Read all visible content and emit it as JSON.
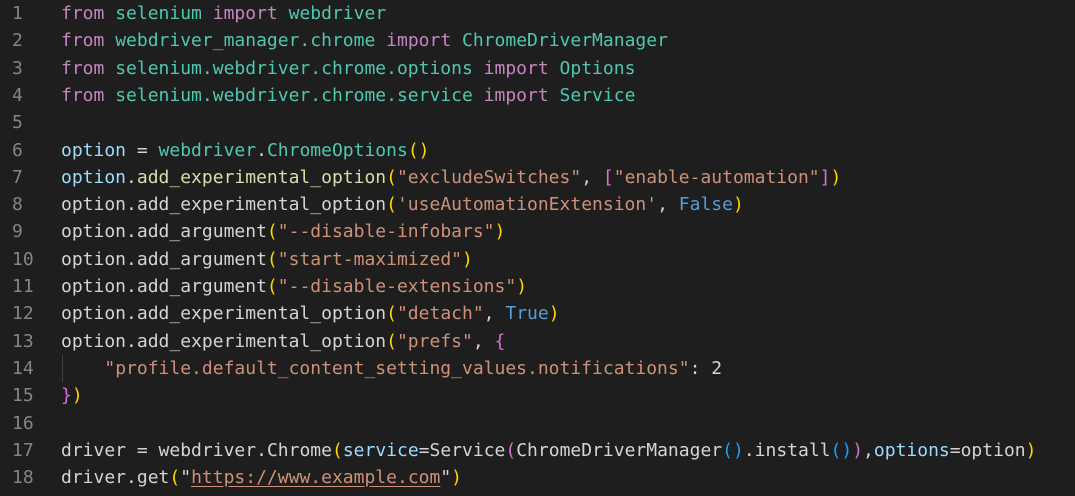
{
  "colors": {
    "background": "#1e1e1e",
    "keyword": "#c586c0",
    "module": "#4ec9b0",
    "function": "#dcdcaa",
    "variable": "#9cdcfe",
    "string": "#ce9178",
    "constant": "#569cd6",
    "bracket_gold": "#ffd700",
    "bracket_purple": "#da70d6",
    "bracket_blue": "#179fff",
    "line_number": "#858585"
  },
  "lines": [
    {
      "num": "1",
      "tokens": [
        {
          "text": "from",
          "cls": "kw"
        },
        {
          "text": " "
        },
        {
          "text": "selenium",
          "cls": "mod"
        },
        {
          "text": " "
        },
        {
          "text": "import",
          "cls": "kw"
        },
        {
          "text": " "
        },
        {
          "text": "webdriver",
          "cls": "mod"
        }
      ]
    },
    {
      "num": "2",
      "tokens": [
        {
          "text": "from",
          "cls": "kw"
        },
        {
          "text": " "
        },
        {
          "text": "webdriver_manager.chrome",
          "cls": "mod"
        },
        {
          "text": " "
        },
        {
          "text": "import",
          "cls": "kw"
        },
        {
          "text": " "
        },
        {
          "text": "ChromeDriverManager",
          "cls": "mod"
        }
      ]
    },
    {
      "num": "3",
      "tokens": [
        {
          "text": "from",
          "cls": "kw"
        },
        {
          "text": " "
        },
        {
          "text": "selenium.webdriver.chrome.options",
          "cls": "mod"
        },
        {
          "text": " "
        },
        {
          "text": "import",
          "cls": "kw"
        },
        {
          "text": " "
        },
        {
          "text": "Options",
          "cls": "mod"
        }
      ]
    },
    {
      "num": "4",
      "tokens": [
        {
          "text": "from",
          "cls": "kw"
        },
        {
          "text": " "
        },
        {
          "text": "selenium.webdriver.chrome.service",
          "cls": "mod"
        },
        {
          "text": " "
        },
        {
          "text": "import",
          "cls": "kw"
        },
        {
          "text": " "
        },
        {
          "text": "Service",
          "cls": "mod"
        }
      ]
    },
    {
      "num": "5",
      "tokens": []
    },
    {
      "num": "6",
      "tokens": [
        {
          "text": "option",
          "cls": "var"
        },
        {
          "text": " = "
        },
        {
          "text": "webdriver",
          "cls": "mod"
        },
        {
          "text": "."
        },
        {
          "text": "ChromeOptions",
          "cls": "mod"
        },
        {
          "text": "()",
          "cls": "b1"
        }
      ]
    },
    {
      "num": "7",
      "tokens": [
        {
          "text": "option",
          "cls": "var"
        },
        {
          "text": "."
        },
        {
          "text": "add_experimental_option",
          "cls": "fn"
        },
        {
          "text": "(",
          "cls": "b1"
        },
        {
          "text": "\"excludeSwitches\"",
          "cls": "str"
        },
        {
          "text": ", "
        },
        {
          "text": "[",
          "cls": "b2"
        },
        {
          "text": "\"enable-automation\"",
          "cls": "str"
        },
        {
          "text": "]",
          "cls": "b2"
        },
        {
          "text": ")",
          "cls": "b1"
        }
      ]
    },
    {
      "num": "8",
      "tokens": [
        {
          "text": "option"
        },
        {
          "text": "."
        },
        {
          "text": "add_experimental_option"
        },
        {
          "text": "(",
          "cls": "b1"
        },
        {
          "text": "'useAutomationExtension'",
          "cls": "str"
        },
        {
          "text": ", "
        },
        {
          "text": "False",
          "cls": "const"
        },
        {
          "text": ")",
          "cls": "b1"
        }
      ]
    },
    {
      "num": "9",
      "tokens": [
        {
          "text": "option"
        },
        {
          "text": "."
        },
        {
          "text": "add_argument"
        },
        {
          "text": "(",
          "cls": "b1"
        },
        {
          "text": "\"--disable-infobars\"",
          "cls": "str"
        },
        {
          "text": ")",
          "cls": "b1"
        }
      ]
    },
    {
      "num": "10",
      "tokens": [
        {
          "text": "option"
        },
        {
          "text": "."
        },
        {
          "text": "add_argument"
        },
        {
          "text": "(",
          "cls": "b1"
        },
        {
          "text": "\"start-maximized\"",
          "cls": "str"
        },
        {
          "text": ")",
          "cls": "b1"
        }
      ]
    },
    {
      "num": "11",
      "tokens": [
        {
          "text": "option"
        },
        {
          "text": "."
        },
        {
          "text": "add_argument"
        },
        {
          "text": "(",
          "cls": "b1"
        },
        {
          "text": "\"--disable-extensions\"",
          "cls": "str"
        },
        {
          "text": ")",
          "cls": "b1"
        }
      ]
    },
    {
      "num": "12",
      "tokens": [
        {
          "text": "option"
        },
        {
          "text": "."
        },
        {
          "text": "add_experimental_option"
        },
        {
          "text": "(",
          "cls": "b1"
        },
        {
          "text": "\"detach\"",
          "cls": "str"
        },
        {
          "text": ", "
        },
        {
          "text": "True",
          "cls": "const"
        },
        {
          "text": ")",
          "cls": "b1"
        }
      ]
    },
    {
      "num": "13",
      "tokens": [
        {
          "text": "option"
        },
        {
          "text": "."
        },
        {
          "text": "add_experimental_option"
        },
        {
          "text": "(",
          "cls": "b1"
        },
        {
          "text": "\"prefs\"",
          "cls": "str"
        },
        {
          "text": ", "
        },
        {
          "text": "{",
          "cls": "b2"
        }
      ]
    },
    {
      "num": "14",
      "tokens": [
        {
          "text": "    "
        },
        {
          "text": "\"profile.default_content_setting_values.notifications\"",
          "cls": "str"
        },
        {
          "text": ": "
        },
        {
          "text": "2"
        }
      ]
    },
    {
      "num": "15",
      "tokens": [
        {
          "text": "}",
          "cls": "b2"
        },
        {
          "text": ")",
          "cls": "b1"
        }
      ]
    },
    {
      "num": "16",
      "tokens": []
    },
    {
      "num": "17",
      "tokens": [
        {
          "text": "driver"
        },
        {
          "text": " = "
        },
        {
          "text": "webdriver"
        },
        {
          "text": "."
        },
        {
          "text": "Chrome"
        },
        {
          "text": "(",
          "cls": "b1"
        },
        {
          "text": "service",
          "cls": "var"
        },
        {
          "text": "="
        },
        {
          "text": "Service"
        },
        {
          "text": "(",
          "cls": "b2"
        },
        {
          "text": "ChromeDriverManager"
        },
        {
          "text": "()",
          "cls": "b3"
        },
        {
          "text": "."
        },
        {
          "text": "install"
        },
        {
          "text": "()",
          "cls": "b3"
        },
        {
          "text": ")",
          "cls": "b2"
        },
        {
          "text": ","
        },
        {
          "text": "options",
          "cls": "var"
        },
        {
          "text": "="
        },
        {
          "text": "option"
        },
        {
          "text": ")",
          "cls": "b1"
        }
      ]
    },
    {
      "num": "18",
      "tokens": [
        {
          "text": "driver"
        },
        {
          "text": "."
        },
        {
          "text": "get"
        },
        {
          "text": "(",
          "cls": "b1"
        },
        {
          "text": "\""
        },
        {
          "text": "https://www.example.com",
          "cls": "str link"
        },
        {
          "text": "\""
        },
        {
          "text": ")",
          "cls": "b1"
        }
      ]
    }
  ]
}
